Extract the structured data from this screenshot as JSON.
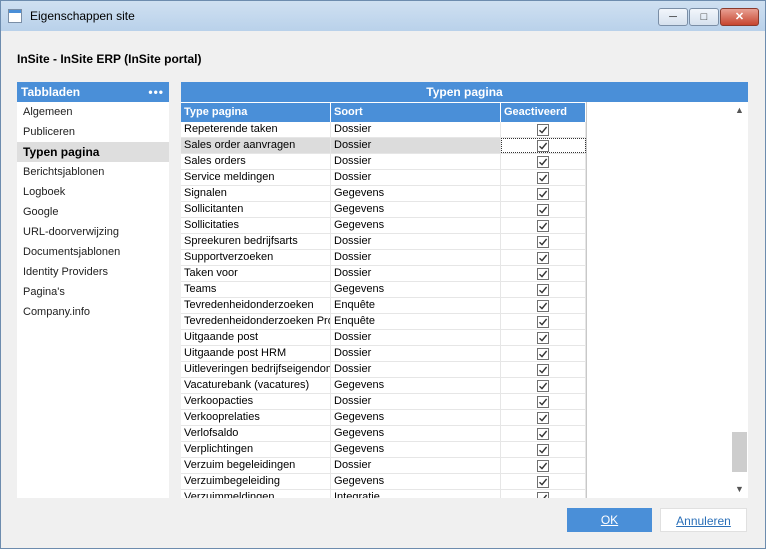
{
  "window": {
    "title": "Eigenschappen site",
    "minimize": "─",
    "maximize": "□",
    "close": "✕"
  },
  "site_heading": "InSite - InSite ERP (InSite portal)",
  "left": {
    "header": "Tabbladen",
    "more": "•••",
    "items": [
      {
        "label": "Algemeen"
      },
      {
        "label": "Publiceren"
      },
      {
        "label": "Typen pagina"
      },
      {
        "label": "Berichtsjablonen"
      },
      {
        "label": "Logboek"
      },
      {
        "label": "Google"
      },
      {
        "label": "URL-doorverwijzing"
      },
      {
        "label": "Documentsjablonen"
      },
      {
        "label": "Identity Providers"
      },
      {
        "label": "Pagina's"
      },
      {
        "label": "Company.info"
      }
    ],
    "selected_index": 2
  },
  "grid": {
    "title": "Typen pagina",
    "columns": [
      "Type pagina",
      "Soort",
      "Geactiveerd"
    ],
    "selected_row": 1,
    "rows": [
      {
        "type": "Repeterende taken",
        "soort": "Dossier",
        "active": true
      },
      {
        "type": "Sales order aanvragen",
        "soort": "Dossier",
        "active": true
      },
      {
        "type": "Sales orders",
        "soort": "Dossier",
        "active": true
      },
      {
        "type": "Service meldingen",
        "soort": "Dossier",
        "active": true
      },
      {
        "type": "Signalen",
        "soort": "Gegevens",
        "active": true
      },
      {
        "type": "Sollicitanten",
        "soort": "Gegevens",
        "active": true
      },
      {
        "type": "Sollicitaties",
        "soort": "Gegevens",
        "active": true
      },
      {
        "type": "Spreekuren bedrijfsarts",
        "soort": "Dossier",
        "active": true
      },
      {
        "type": "Supportverzoeken",
        "soort": "Dossier",
        "active": true
      },
      {
        "type": "Taken voor",
        "soort": "Dossier",
        "active": true
      },
      {
        "type": "Teams",
        "soort": "Gegevens",
        "active": true
      },
      {
        "type": "Tevredenheidonderzoeken",
        "soort": "Enquête",
        "active": true
      },
      {
        "type": "Tevredenheidonderzoeken Pro",
        "soort": "Enquête",
        "active": true
      },
      {
        "type": "Uitgaande post",
        "soort": "Dossier",
        "active": true
      },
      {
        "type": "Uitgaande post HRM",
        "soort": "Dossier",
        "active": true
      },
      {
        "type": "Uitleveringen bedrijfseigendom",
        "soort": "Dossier",
        "active": true
      },
      {
        "type": "Vacaturebank (vacatures)",
        "soort": "Gegevens",
        "active": true
      },
      {
        "type": "Verkoopacties",
        "soort": "Dossier",
        "active": true
      },
      {
        "type": "Verkooprelaties",
        "soort": "Gegevens",
        "active": true
      },
      {
        "type": "Verlofsaldo",
        "soort": "Gegevens",
        "active": true
      },
      {
        "type": "Verplichtingen",
        "soort": "Gegevens",
        "active": true
      },
      {
        "type": "Verzuim begeleidingen",
        "soort": "Dossier",
        "active": true
      },
      {
        "type": "Verzuimbegeleiding",
        "soort": "Gegevens",
        "active": true
      },
      {
        "type": "Verzuimmeldingen",
        "soort": "Integratie",
        "active": true
      }
    ]
  },
  "buttons": {
    "ok": "OK",
    "cancel": "Annuleren"
  },
  "colors": {
    "accent": "#4a8fd8",
    "selected_row": "#dcdcdc"
  }
}
